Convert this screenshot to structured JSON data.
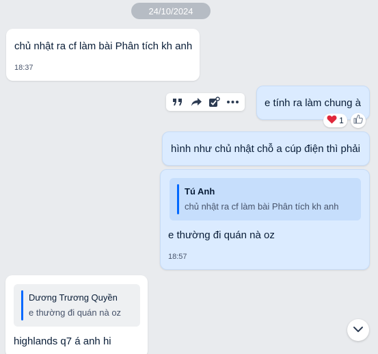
{
  "date_separator": "24/10/2024",
  "messages": [
    {
      "text": "chủ nhật ra cf làm bài Phân tích kh anh",
      "time": "18:37"
    },
    {
      "text": "e tính ra làm chung à",
      "reaction": {
        "icon": "heart-icon",
        "count": "1"
      }
    },
    {
      "text": "hình như chủ nhật chỗ a cúp điện thì phải"
    },
    {
      "quote": {
        "author": "Tú Anh",
        "text": "chủ nhật ra cf làm bài Phân tích kh anh"
      },
      "text": "e thường đi quán nà oz",
      "time": "18:57"
    },
    {
      "quote": {
        "author": "Dương Trương Quyền",
        "text": "e thường đi quán nà oz"
      },
      "text": "highlands q7 á anh hi"
    }
  ],
  "toolbar": {
    "icons": [
      "quote-icon",
      "share-icon",
      "task-icon",
      "more-icon"
    ]
  },
  "colors": {
    "sent_bubble": "#dbebff",
    "received_bubble": "#ffffff",
    "accent": "#0068ff",
    "background": "#e9ebee"
  }
}
